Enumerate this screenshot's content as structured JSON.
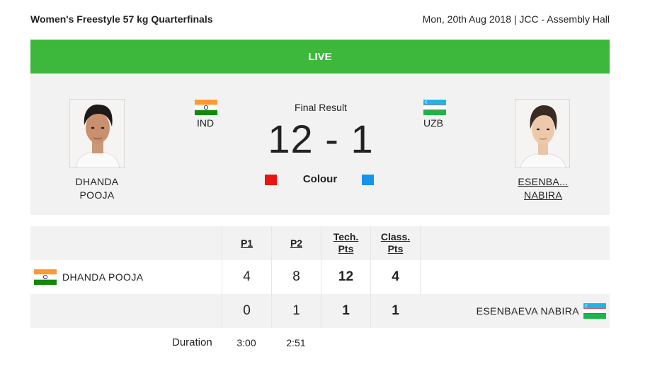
{
  "event": {
    "title": "Women's Freestyle 57 kg Quarterfinals",
    "meta": "Mon, 20th Aug 2018 | JCC - Assembly Hall"
  },
  "status": "LIVE",
  "result": {
    "label": "Final Result",
    "score": "12 - 1",
    "colour_label": "Colour",
    "red_color": "#ee1111",
    "blue_color": "#1493f0"
  },
  "red": {
    "first_line": "DHANDA",
    "second_line": "POOJA",
    "nat": "IND",
    "full_name": "DHANDA POOJA",
    "flag_icon": "india-flag-icon"
  },
  "blue": {
    "first_line": "ESENBA...",
    "second_line": "NABIRA",
    "nat": "UZB",
    "full_name": "ESENBAEVA NABIRA",
    "flag_icon": "uzbekistan-flag-icon"
  },
  "table": {
    "headers": {
      "p1": "P1",
      "p2": "P2",
      "tech_line1": "Tech.",
      "tech_line2": "Pts",
      "class_line1": "Class.",
      "class_line2": "Pts"
    },
    "red_row": {
      "p1": "4",
      "p2": "8",
      "tech": "12",
      "class": "4"
    },
    "blue_row": {
      "p1": "0",
      "p2": "1",
      "tech": "1",
      "class": "1"
    },
    "duration": {
      "label": "Duration",
      "p1": "3:00",
      "p2": "2:51"
    }
  },
  "colors": {
    "live_green": "#3db83d",
    "panel_grey": "#f2f2f2"
  }
}
